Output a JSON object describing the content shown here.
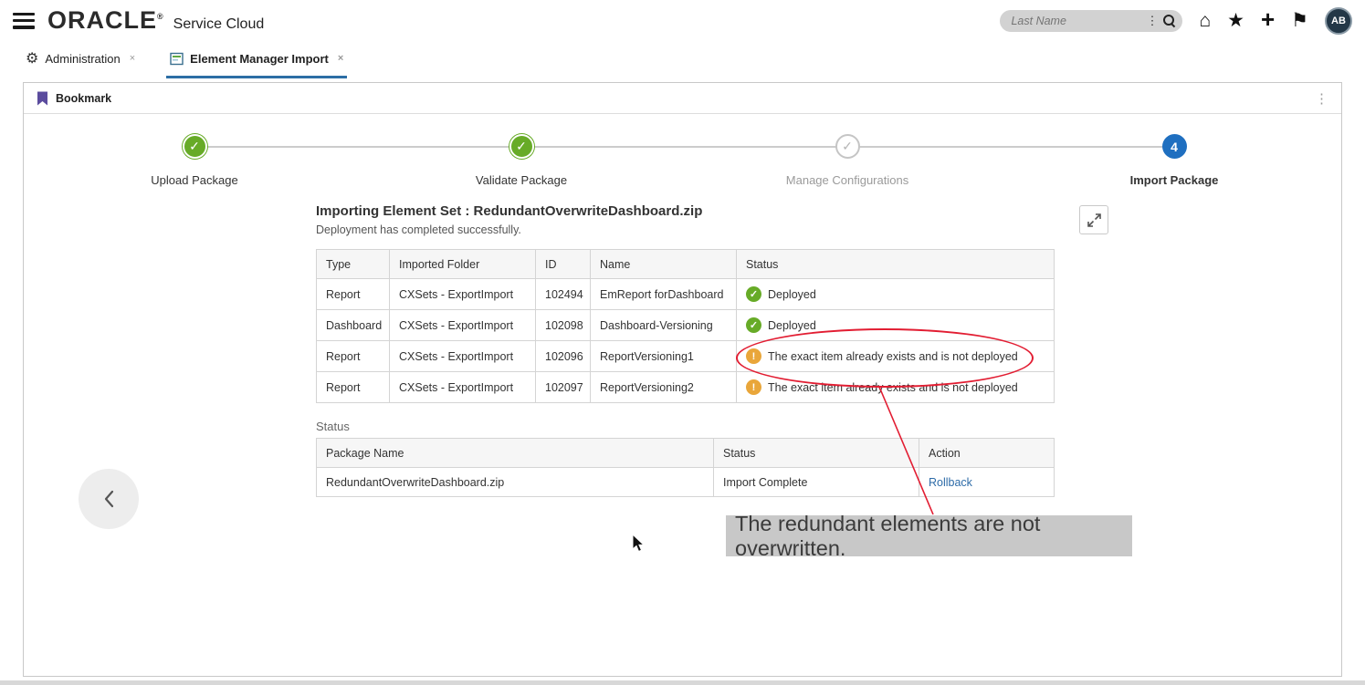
{
  "header": {
    "brand": "ORACLE",
    "brand_mark": "®",
    "product": "Service Cloud",
    "search_placeholder": "Last Name",
    "avatar_initials": "AB"
  },
  "icons": {
    "home": "⌂",
    "star": "★",
    "add": "+",
    "flag": "⚑",
    "more": "⋮",
    "dots": "⋮",
    "close": "×",
    "gear": "⚙",
    "check": "✓",
    "warning": "!",
    "step4": "4"
  },
  "tabs": [
    {
      "label": "Administration"
    },
    {
      "label": "Element Manager Import"
    }
  ],
  "panel": {
    "bookmark_label": "Bookmark"
  },
  "stepper": {
    "steps": [
      {
        "label": "Upload Package",
        "state": "complete"
      },
      {
        "label": "Validate Package",
        "state": "complete"
      },
      {
        "label": "Manage Configurations",
        "state": "incomplete"
      },
      {
        "label": "Import Package",
        "state": "current",
        "number": "4"
      }
    ]
  },
  "import_section": {
    "title": "Importing Element Set : RedundantOverwriteDashboard.zip",
    "subtitle": "Deployment has completed successfully.",
    "table": {
      "headers": [
        "Type",
        "Imported Folder",
        "ID",
        "Name",
        "Status"
      ],
      "rows": [
        {
          "type": "Report",
          "folder": "CXSets - ExportImport",
          "id": "102494",
          "name": "EmReport forDashboard",
          "status": "Deployed",
          "status_kind": "success"
        },
        {
          "type": "Dashboard",
          "folder": "CXSets - ExportImport",
          "id": "102098",
          "name": "Dashboard-Versioning",
          "status": "Deployed",
          "status_kind": "success"
        },
        {
          "type": "Report",
          "folder": "CXSets - ExportImport",
          "id": "102096",
          "name": "ReportVersioning1",
          "status": "The exact item already exists and is not deployed",
          "status_kind": "warning"
        },
        {
          "type": "Report",
          "folder": "CXSets - ExportImport",
          "id": "102097",
          "name": "ReportVersioning2",
          "status": "The exact item already exists and is not deployed",
          "status_kind": "warning"
        }
      ]
    },
    "status_section_label": "Status",
    "status_table": {
      "headers": [
        "Package Name",
        "Status",
        "Action"
      ],
      "rows": [
        {
          "package_name": "RedundantOverwriteDashboard.zip",
          "status": "Import Complete",
          "action": "Rollback"
        }
      ]
    }
  },
  "annotation": {
    "callout": "The redundant elements are not overwritten."
  },
  "colors": {
    "success_green": "#67ab27",
    "warning_orange": "#e9a63a",
    "current_step_blue": "#1f6fc0",
    "annotation_red": "#e21d32",
    "active_tab_blue": "#2c6ea5",
    "link_blue": "#2e6ca8",
    "callout_gray": "#c8c8c8"
  }
}
